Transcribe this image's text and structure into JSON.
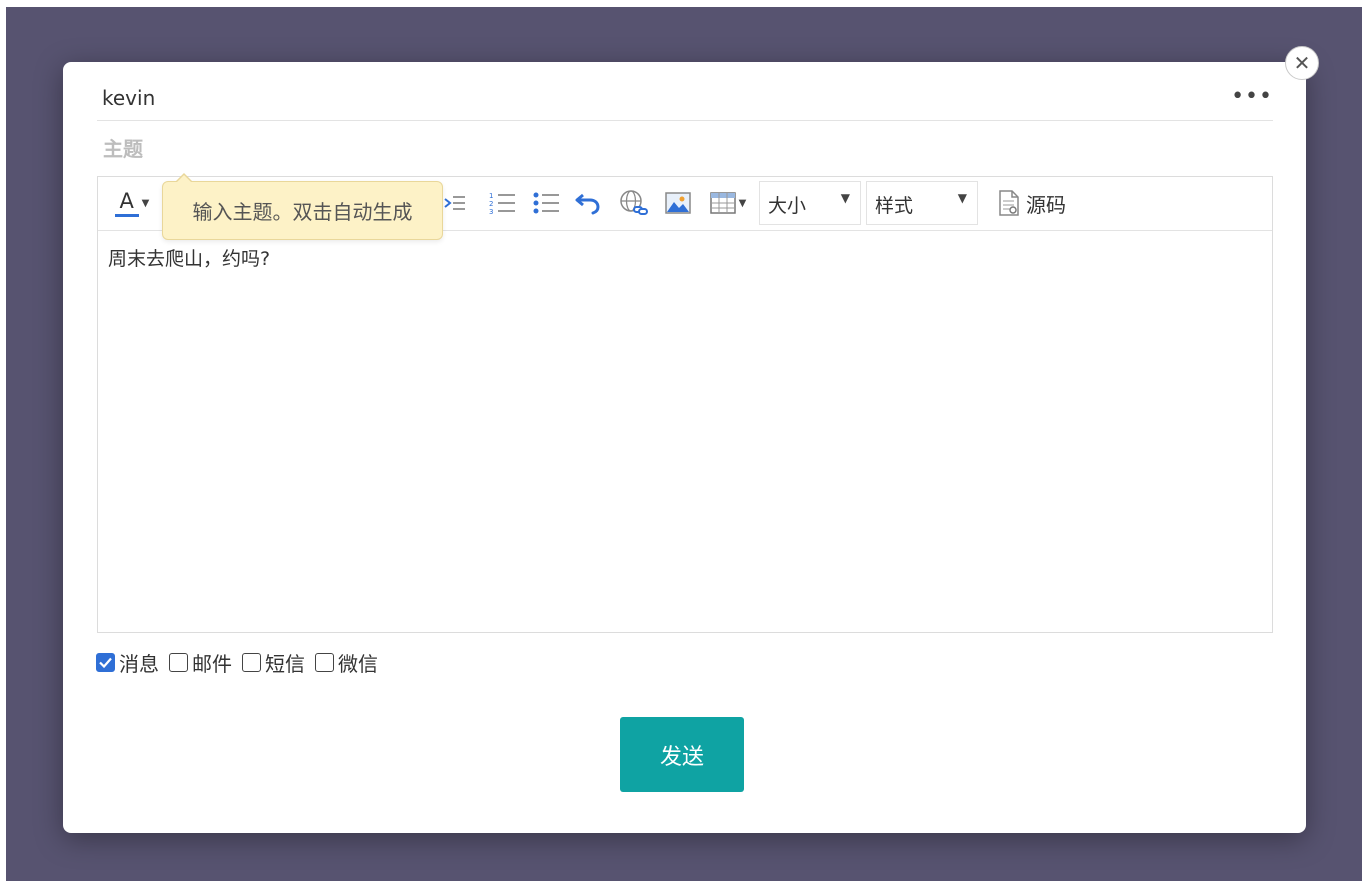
{
  "recipient": "kevin",
  "more_menu": "•••",
  "subject": {
    "placeholder": "主题",
    "value": ""
  },
  "tooltip": "输入主题。双击自动生成",
  "toolbar": {
    "font_color_label": "A",
    "size_select": "大小",
    "style_select": "样式",
    "source_label": "源码"
  },
  "body_text": "周末去爬山，约吗?",
  "channels": [
    {
      "label": "消息",
      "checked": true
    },
    {
      "label": "邮件",
      "checked": false
    },
    {
      "label": "短信",
      "checked": false
    },
    {
      "label": "微信",
      "checked": false
    }
  ],
  "send_label": "发送",
  "close_glyph": "✕",
  "colors": {
    "backdrop": "#575370",
    "send_button": "#0fa3a3",
    "tooltip_bg": "#fdf2c7",
    "checkbox_checked": "#2f6fd6",
    "icon_blue": "#2f6fd6"
  }
}
